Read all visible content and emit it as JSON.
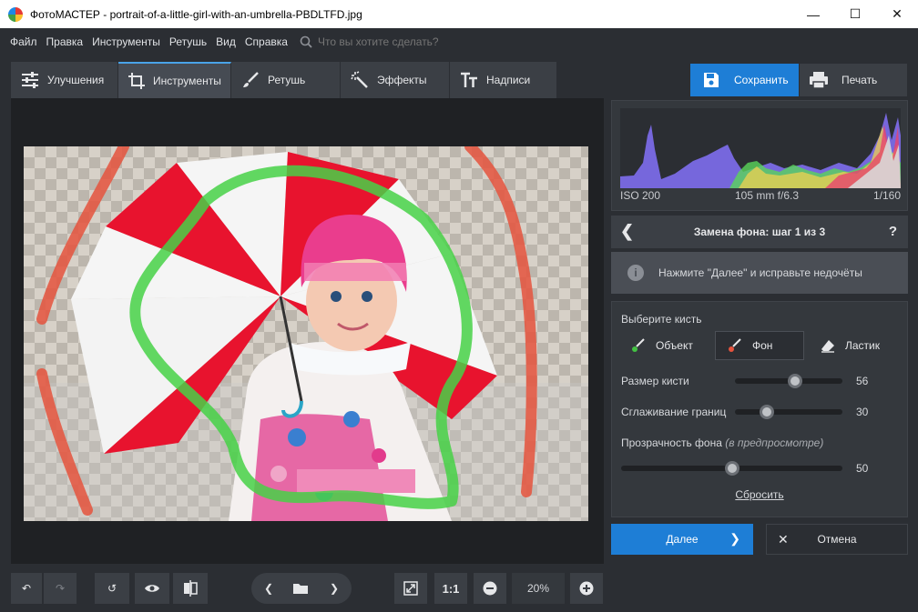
{
  "window": {
    "title": "ФотоМАСТЕР - portrait-of-a-little-girl-with-an-umbrella-PBDLTFD.jpg",
    "controls": [
      "minimize-icon",
      "maximize-icon",
      "close-icon"
    ]
  },
  "menu": {
    "items": [
      "Файл",
      "Правка",
      "Инструменты",
      "Ретушь",
      "Вид",
      "Справка"
    ],
    "search_placeholder": "Что вы хотите сделать?"
  },
  "tabs": [
    {
      "label": "Улучшения",
      "icon": "sliders-icon",
      "active": false
    },
    {
      "label": "Инструменты",
      "icon": "crop-icon",
      "active": true
    },
    {
      "label": "Ретушь",
      "icon": "brush-icon",
      "active": false
    },
    {
      "label": "Эффекты",
      "icon": "magic-wand-icon",
      "active": false
    },
    {
      "label": "Надписи",
      "icon": "text-icon",
      "active": false
    }
  ],
  "actions": {
    "save_label": "Сохранить",
    "print_label": "Печать"
  },
  "histogram": {
    "iso": "ISO 200",
    "lens": "105 mm f/6.3",
    "shutter": "1/160"
  },
  "step": {
    "title": "Замена фона: шаг 1 из 3",
    "help": "?",
    "hint": "Нажмите \"Далее\" и исправьте недочёты"
  },
  "brush": {
    "choose_label": "Выберите кисть",
    "options": [
      {
        "label": "Объект",
        "active": false,
        "color": "#43c243"
      },
      {
        "label": "Фон",
        "active": true,
        "color": "#e5533d"
      },
      {
        "label": "Ластик",
        "active": false
      }
    ],
    "size": {
      "label": "Размер кисти",
      "value": 56,
      "max": 100
    },
    "smooth": {
      "label": "Сглаживание границ",
      "value": 30,
      "max": 100
    },
    "opacity": {
      "label": "Прозрачность фона",
      "note": "(в предпросмотре)",
      "value": 50,
      "max": 100
    },
    "reset_label": "Сбросить"
  },
  "footer": {
    "next_label": "Далее",
    "cancel_label": "Отмена"
  },
  "bottom": {
    "ratio": "1:1",
    "zoom": "20%"
  },
  "colors": {
    "accent": "#1e7ed6",
    "object_brush": "#43c243",
    "background_brush": "#e5533d"
  }
}
